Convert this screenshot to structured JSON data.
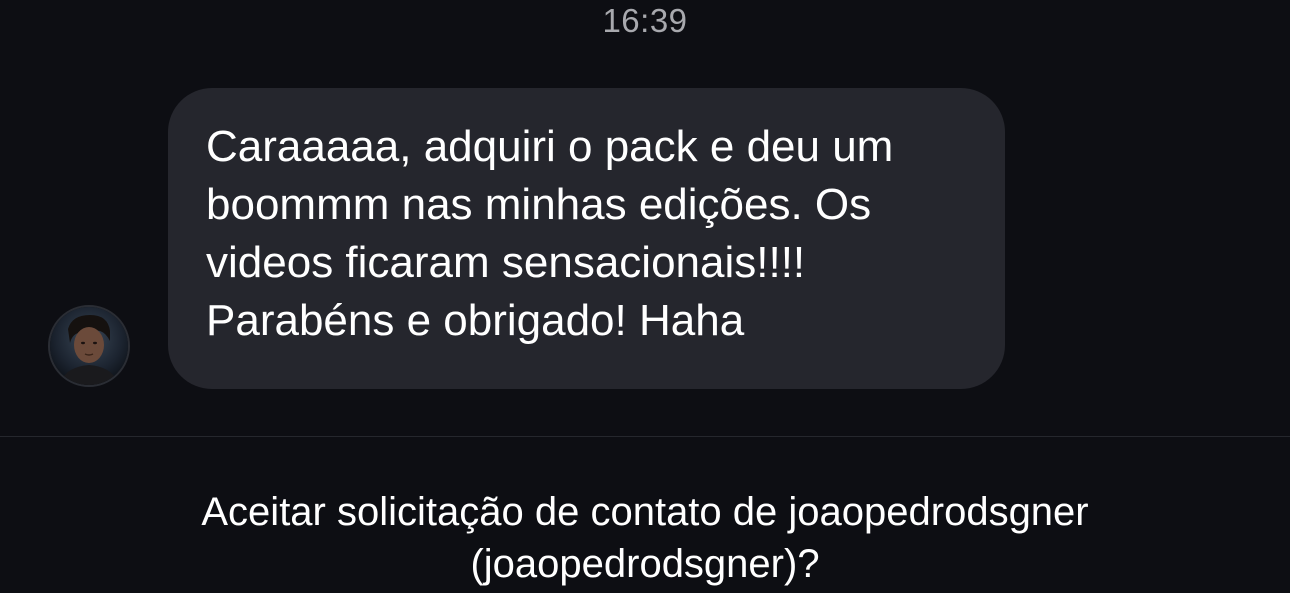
{
  "chat": {
    "timestamp": "16:39",
    "message": {
      "text": "Caraaaaa, adquiri o pack e deu um\nboommm nas minhas edições. Os\nvideos ficaram sensacionais!!!!\nParabéns e obrigado! Haha"
    },
    "sender_avatar_icon": "avatar-icon"
  },
  "contact_request": {
    "line1": "Aceitar solicitação de contato de joaopedrodsgner",
    "line2": "(joaopedrodsgner)?"
  },
  "colors": {
    "background": "#0d0e13",
    "bubble": "#25262d",
    "timestamp": "#a8a9ae",
    "divider": "#25272d"
  }
}
